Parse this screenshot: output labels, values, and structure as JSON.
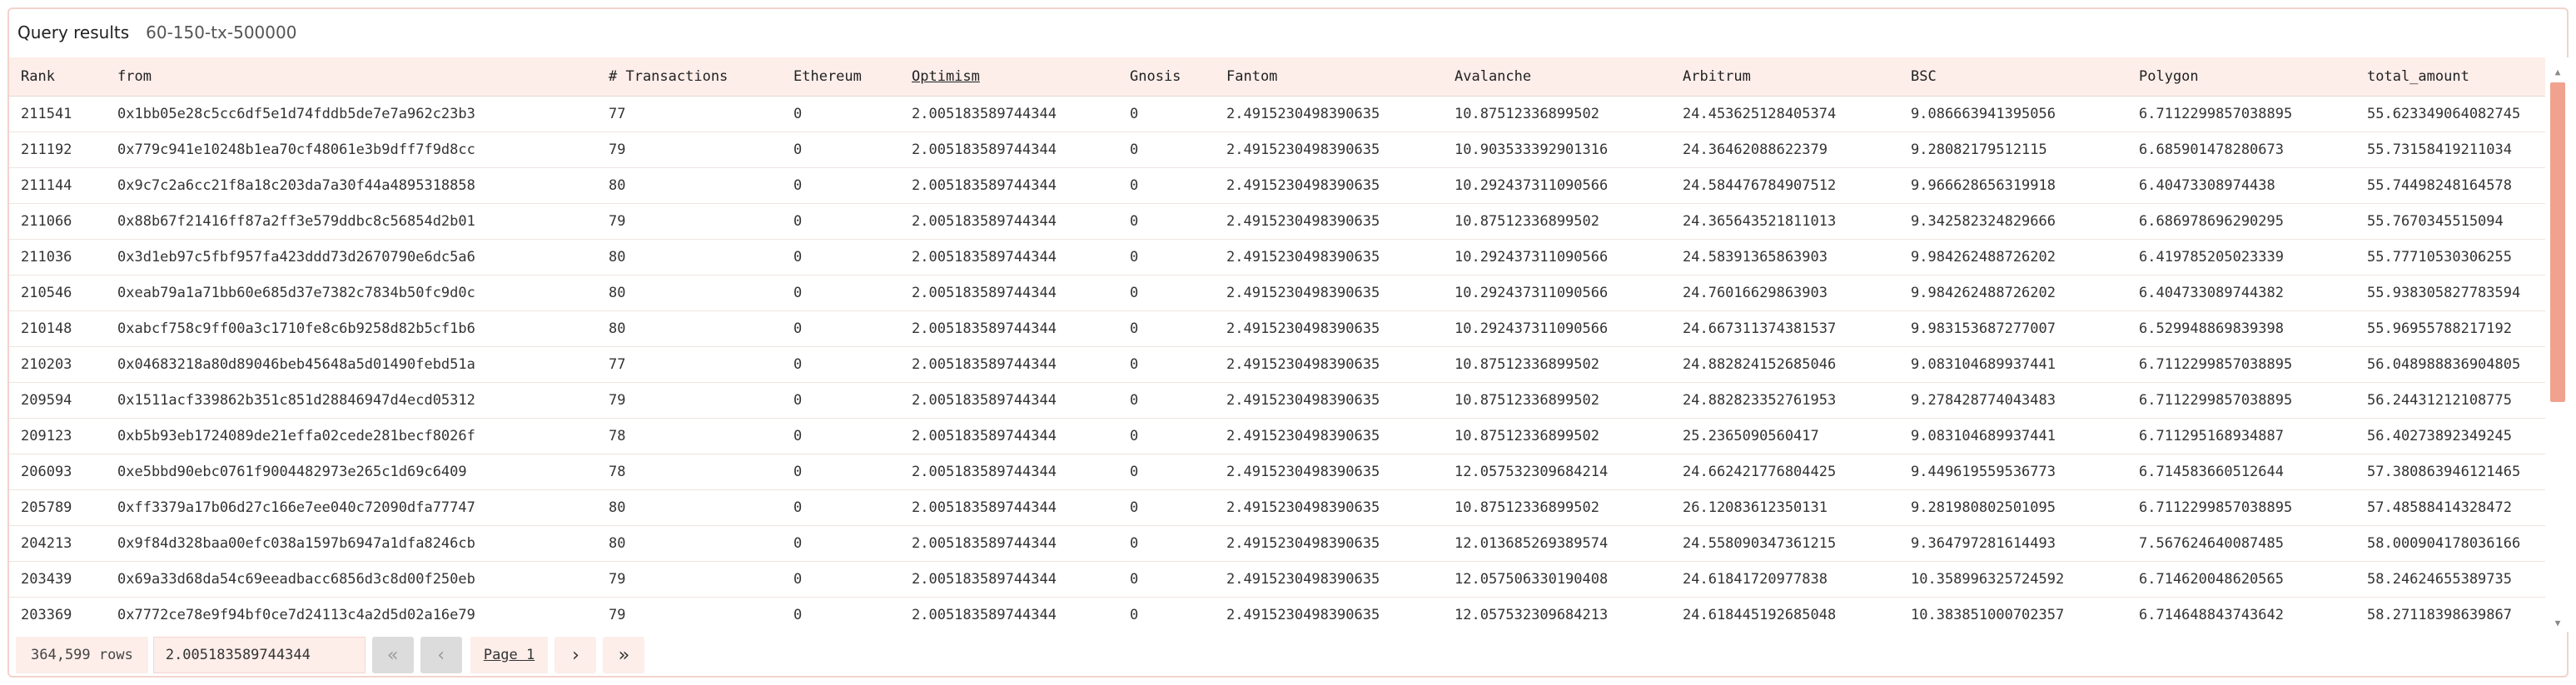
{
  "header": {
    "title": "Query results",
    "subtitle": "60-150-tx-500000"
  },
  "table": {
    "columns": [
      {
        "key": "rank",
        "label": "Rank"
      },
      {
        "key": "from",
        "label": "from"
      },
      {
        "key": "tx",
        "label": "# Transactions"
      },
      {
        "key": "ethereum",
        "label": "Ethereum"
      },
      {
        "key": "optimism",
        "label": "Optimism"
      },
      {
        "key": "gnosis",
        "label": "Gnosis"
      },
      {
        "key": "fantom",
        "label": "Fantom"
      },
      {
        "key": "avalanche",
        "label": "Avalanche"
      },
      {
        "key": "arbitrum",
        "label": "Arbitrum"
      },
      {
        "key": "bsc",
        "label": "BSC"
      },
      {
        "key": "polygon",
        "label": "Polygon"
      },
      {
        "key": "total_amount",
        "label": "total_amount"
      }
    ],
    "rows": [
      [
        "211541",
        "0x1bb05e28c5cc6df5e1d74fddb5de7e7a962c23b3",
        "77",
        "0",
        "2.005183589744344",
        "0",
        "2.4915230498390635",
        "10.87512336899502",
        "24.453625128405374",
        "9.086663941395056",
        "6.7112299857038895",
        "55.623349064082745"
      ],
      [
        "211192",
        "0x779c941e10248b1ea70cf48061e3b9dff7f9d8cc",
        "79",
        "0",
        "2.005183589744344",
        "0",
        "2.4915230498390635",
        "10.903533392901316",
        "24.36462088622379",
        "9.28082179512115",
        "6.685901478280673",
        "55.73158419211034"
      ],
      [
        "211144",
        "0x9c7c2a6cc21f8a18c203da7a30f44a4895318858",
        "80",
        "0",
        "2.005183589744344",
        "0",
        "2.4915230498390635",
        "10.292437311090566",
        "24.584476784907512",
        "9.966628656319918",
        "6.40473308974438",
        "55.74498248164578"
      ],
      [
        "211066",
        "0x88b67f21416ff87a2ff3e579ddbc8c56854d2b01",
        "79",
        "0",
        "2.005183589744344",
        "0",
        "2.4915230498390635",
        "10.87512336899502",
        "24.365643521811013",
        "9.342582324829666",
        "6.686978696290295",
        "55.7670345515094"
      ],
      [
        "211036",
        "0x3d1eb97c5fbf957fa423ddd73d2670790e6dc5a6",
        "80",
        "0",
        "2.005183589744344",
        "0",
        "2.4915230498390635",
        "10.292437311090566",
        "24.58391365863903",
        "9.984262488726202",
        "6.419785205023339",
        "55.77710530306255"
      ],
      [
        "210546",
        "0xeab79a1a71bb60e685d37e7382c7834b50fc9d0c",
        "80",
        "0",
        "2.005183589744344",
        "0",
        "2.4915230498390635",
        "10.292437311090566",
        "24.76016629863903",
        "9.984262488726202",
        "6.404733089744382",
        "55.938305827783594"
      ],
      [
        "210148",
        "0xabcf758c9ff00a3c1710fe8c6b9258d82b5cf1b6",
        "80",
        "0",
        "2.005183589744344",
        "0",
        "2.4915230498390635",
        "10.292437311090566",
        "24.667311374381537",
        "9.983153687277007",
        "6.529948869839398",
        "55.96955788217192"
      ],
      [
        "210203",
        "0x04683218a80d89046beb45648a5d01490febd51a",
        "77",
        "0",
        "2.005183589744344",
        "0",
        "2.4915230498390635",
        "10.87512336899502",
        "24.882824152685046",
        "9.083104689937441",
        "6.7112299857038895",
        "56.048988836904805"
      ],
      [
        "209594",
        "0x1511acf339862b351c851d28846947d4ecd05312",
        "79",
        "0",
        "2.005183589744344",
        "0",
        "2.4915230498390635",
        "10.87512336899502",
        "24.882823352761953",
        "9.278428774043483",
        "6.7112299857038895",
        "56.24431212108775"
      ],
      [
        "209123",
        "0xb5b93eb1724089de21effa02cede281becf8026f",
        "78",
        "0",
        "2.005183589744344",
        "0",
        "2.4915230498390635",
        "10.87512336899502",
        "25.2365090560417",
        "9.083104689937441",
        "6.711295168934887",
        "56.40273892349245"
      ],
      [
        "206093",
        "0xe5bbd90ebc0761f9004482973e265c1d69c6409",
        "78",
        "0",
        "2.005183589744344",
        "0",
        "2.4915230498390635",
        "12.057532309684214",
        "24.662421776804425",
        "9.449619559536773",
        "6.714583660512644",
        "57.380863946121465"
      ],
      [
        "205789",
        "0xff3379a17b06d27c166e7ee040c72090dfa77747",
        "80",
        "0",
        "2.005183589744344",
        "0",
        "2.4915230498390635",
        "10.87512336899502",
        "26.12083612350131",
        "9.281980802501095",
        "6.7112299857038895",
        "57.48588414328472"
      ],
      [
        "204213",
        "0x9f84d328baa00efc038a1597b6947a1dfa8246cb",
        "80",
        "0",
        "2.005183589744344",
        "0",
        "2.4915230498390635",
        "12.013685269389574",
        "24.558090347361215",
        "9.364797281614493",
        "7.567624640087485",
        "58.000904178036166"
      ],
      [
        "203439",
        "0x69a33d68da54c69eeadbacc6856d3c8d00f250eb",
        "79",
        "0",
        "2.005183589744344",
        "0",
        "2.4915230498390635",
        "12.057506330190408",
        "24.61841720977838",
        "10.358996325724592",
        "6.714620048620565",
        "58.24624655389735"
      ],
      [
        "203369",
        "0x7772ce78e9f94bf0ce7d24113c4a2d5d02a16e79",
        "79",
        "0",
        "2.005183589744344",
        "0",
        "2.4915230498390635",
        "12.057532309684213",
        "24.618445192685048",
        "10.383851000702357",
        "6.714648843743642",
        "58.27118398639867"
      ]
    ]
  },
  "footer": {
    "rows_label": "364,599 rows",
    "selected_value": "2.005183589744344",
    "page_label": "Page 1",
    "first_icon": "double-chevron-left",
    "prev_icon": "chevron-left",
    "next_icon": "chevron-right",
    "last_icon": "double-chevron-right"
  },
  "colors": {
    "accent": "#f1a28f",
    "header_bg": "#fdeeea",
    "border": "#f3d3cc"
  }
}
